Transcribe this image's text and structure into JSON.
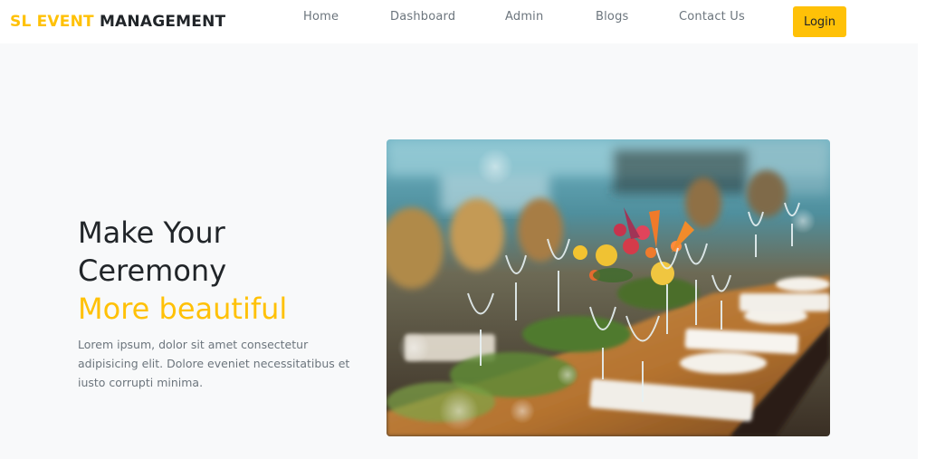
{
  "navbar": {
    "brand_part1": "SL EVENT",
    "brand_part2": "MANAGEMENT",
    "links": [
      "Home",
      "Dashboard",
      "Admin",
      "Blogs",
      "Contact Us"
    ],
    "login_label": "Login"
  },
  "hero": {
    "line1": "Make Your",
    "line2": "Ceremony",
    "line3": "More beautiful",
    "description": "Lorem ipsum, dolor sit amet consectetur adipisicing elit. Dolore eveniet necessitatibus et iusto corrupti minima.",
    "image_subject": "banquet-table-photo"
  },
  "colors": {
    "accent": "#ffc107",
    "text_dark": "#212529",
    "text_muted": "#6c757d",
    "page_bg": "#f8f9fa"
  }
}
